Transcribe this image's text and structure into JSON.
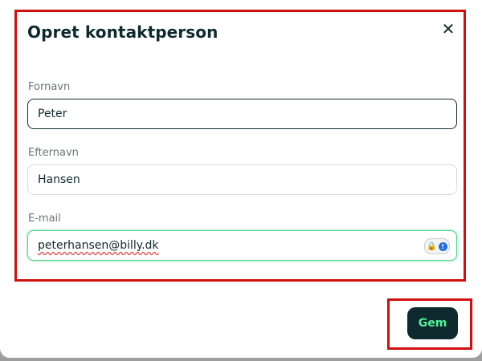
{
  "dialog": {
    "title": "Opret kontaktperson",
    "close_icon": "close-icon"
  },
  "form": {
    "first_name": {
      "label": "Fornavn",
      "value": "Peter"
    },
    "last_name": {
      "label": "Efternavn",
      "value": "Hansen"
    },
    "email": {
      "label": "E-mail",
      "value": "peterhansen@billy.dk",
      "icon": "password-manager-icon"
    }
  },
  "actions": {
    "save_label": "Gem"
  },
  "colors": {
    "primary_dark": "#0f2a2e",
    "accent_green": "#4ff29a",
    "highlight_red": "#d10f0f",
    "email_focus_border": "#4fd28c"
  }
}
